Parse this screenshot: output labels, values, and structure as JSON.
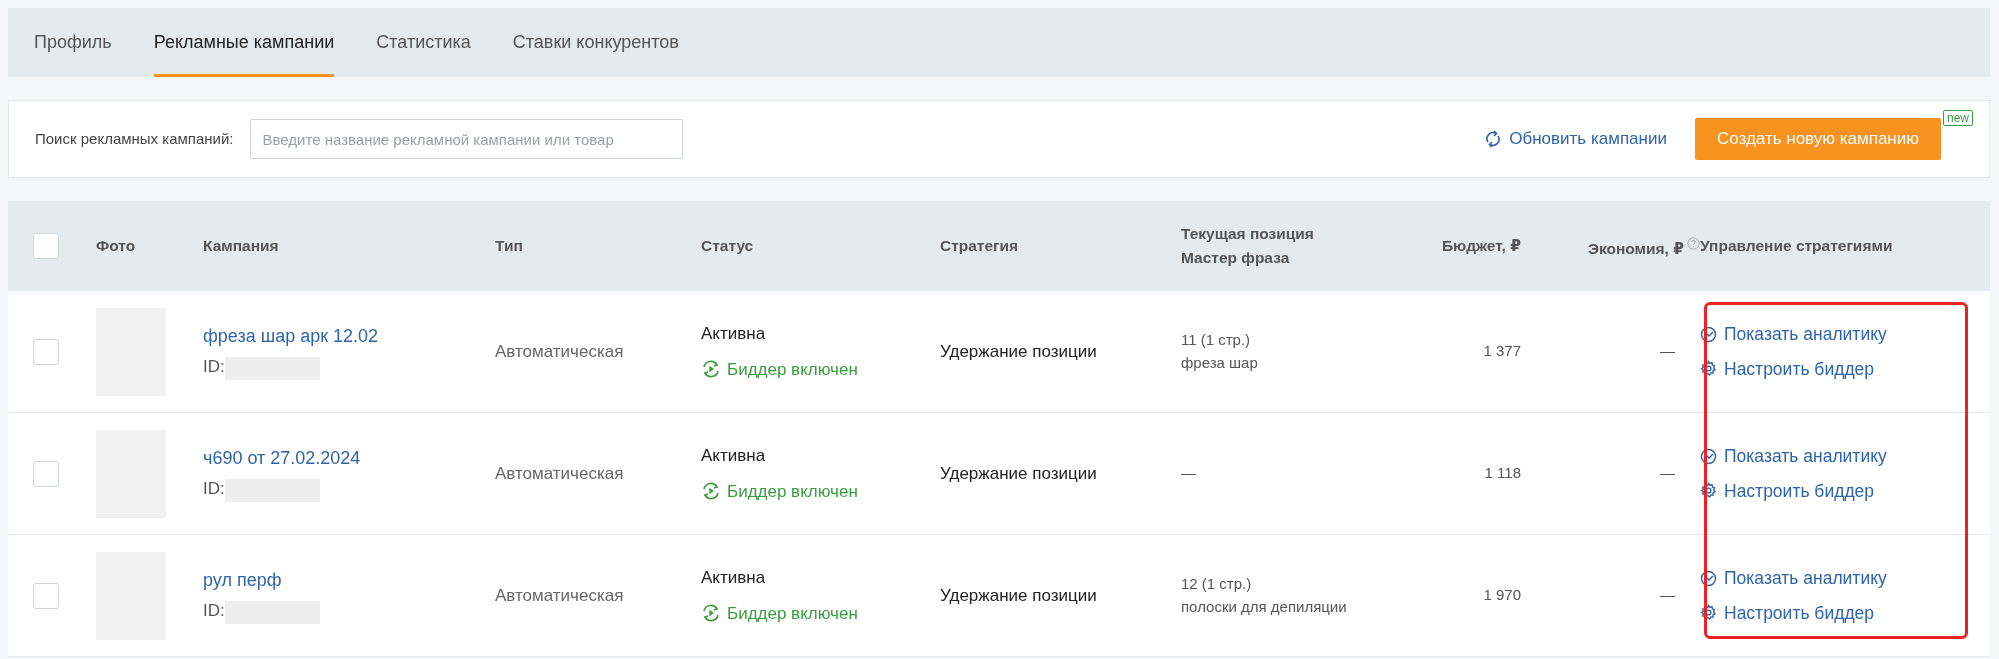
{
  "tabs": [
    {
      "label": "Профиль",
      "selected": false
    },
    {
      "label": "Рекламные кампании",
      "selected": true
    },
    {
      "label": "Статистика",
      "selected": false
    },
    {
      "label": "Ставки конкурентов",
      "selected": false
    }
  ],
  "search": {
    "label": "Поиск рекламных кампаний:",
    "placeholder": "Введите название рекламной кампании или товар"
  },
  "refresh_link": "Обновить кампании",
  "create_button": {
    "label": "Создать новую кампанию",
    "badge": "new"
  },
  "table": {
    "select_all_checked": false,
    "columns": [
      "Фото",
      "Кампания",
      "Тип",
      "Статус",
      "Стратегия",
      "Текущая позиция\nМастер фраза",
      "Бюджет, ₽",
      "Экономия, ₽",
      "Управление стратегиями"
    ],
    "strategy_controls_highlighted": true,
    "rows": [
      {
        "checked": false,
        "name": "фреза шар арк 12.02",
        "id_label": "ID:",
        "type": "Автоматическая",
        "status": "Активна",
        "bidder": {
          "label": "Биддер включен",
          "on": true
        },
        "strategy": "Удержание позиции",
        "position": "11 (1 стр.)",
        "phrase": "фреза шар",
        "budget": "1 377",
        "economy": "—",
        "actions": [
          {
            "kind": "analytics",
            "label": "Показать аналитику"
          },
          {
            "kind": "settings",
            "label": "Настроить биддер"
          }
        ]
      },
      {
        "checked": false,
        "name": "ч690 от 27.02.2024",
        "id_label": "ID:",
        "type": "Автоматическая",
        "status": "Активна",
        "bidder": {
          "label": "Биддер включен",
          "on": true
        },
        "strategy": "Удержание позиции",
        "position": "—",
        "budget": "1 118",
        "economy": "—",
        "actions": [
          {
            "kind": "analytics",
            "label": "Показать аналитику"
          },
          {
            "kind": "settings",
            "label": "Настроить биддер"
          }
        ]
      },
      {
        "checked": false,
        "name": "рул перф",
        "id_label": "ID:",
        "type": "Автоматическая",
        "status": "Активна",
        "bidder": {
          "label": "Биддер включен",
          "on": true
        },
        "strategy": "Удержание позиции",
        "position": "12 (1 стр.)",
        "phrase": "полоски для депиляции",
        "budget": "1 970",
        "economy": "—",
        "actions": [
          {
            "kind": "analytics",
            "label": "Показать аналитику"
          },
          {
            "kind": "settings",
            "label": "Настроить биддер"
          }
        ]
      }
    ]
  }
}
